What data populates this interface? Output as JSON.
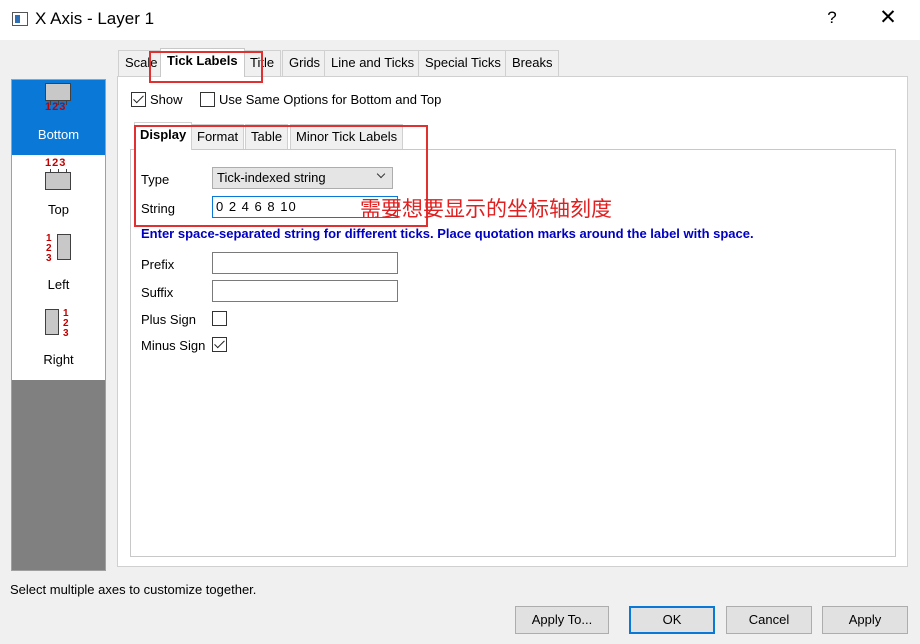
{
  "window": {
    "title": "X Axis - Layer 1",
    "help": "?",
    "close": "✕"
  },
  "axis_list": [
    {
      "label": "Bottom",
      "numbers": "123",
      "selected": true
    },
    {
      "label": "Top",
      "numbers": "123",
      "selected": false
    },
    {
      "label": "Left",
      "numbers": [
        "1",
        "2",
        "3"
      ],
      "selected": false
    },
    {
      "label": "Right",
      "numbers": [
        "1",
        "2",
        "3"
      ],
      "selected": false
    }
  ],
  "tabs": [
    "Scale",
    "Tick Labels",
    "Title",
    "Grids",
    "Line and Ticks",
    "Special Ticks",
    "Breaks"
  ],
  "active_tab": "Tick Labels",
  "show_checkbox": {
    "label": "Show",
    "checked": true
  },
  "same_options_checkbox": {
    "label": "Use Same Options for Bottom and Top",
    "checked": false
  },
  "inner_tabs": [
    "Display",
    "Format",
    "Table",
    "Minor Tick Labels"
  ],
  "active_inner_tab": "Display",
  "form": {
    "type_label": "Type",
    "type_value": "Tick-indexed string",
    "string_label": "String",
    "string_value": "0 2 4 6 8 10",
    "hint": "Enter space-separated string for different ticks. Place quotation marks around the label with space.",
    "prefix_label": "Prefix",
    "prefix_value": "",
    "suffix_label": "Suffix",
    "suffix_value": "",
    "plus_sign_label": "Plus Sign",
    "plus_sign_checked": false,
    "minus_sign_label": "Minus Sign",
    "minus_sign_checked": true
  },
  "annotation": "需要想要显示的坐标轴刻度",
  "status": "Select multiple axes to customize together.",
  "buttons": {
    "apply_to": "Apply To...",
    "ok": "OK",
    "cancel": "Cancel",
    "apply": "Apply"
  },
  "colors": {
    "accent": "#0a78d7",
    "annotation": "#e02020",
    "hint": "#0000c0",
    "axis_numbers": "#c00000"
  }
}
